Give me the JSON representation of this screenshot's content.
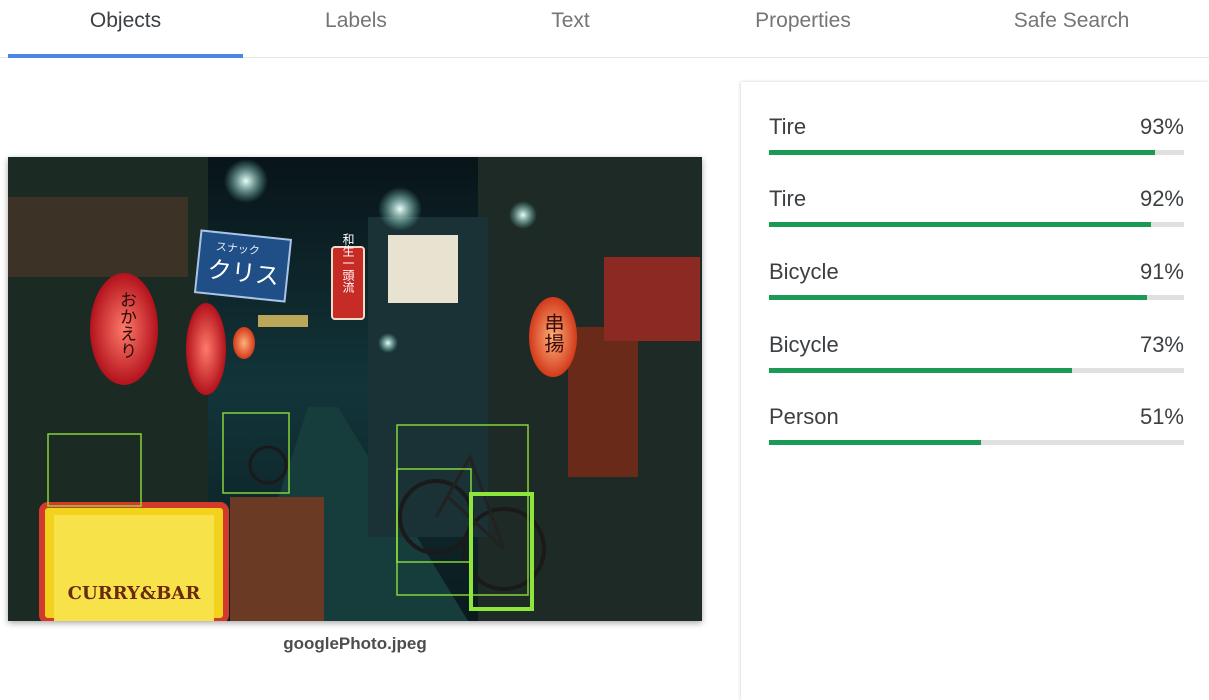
{
  "tabs": [
    {
      "label": "Objects",
      "active": true
    },
    {
      "label": "Labels",
      "active": false
    },
    {
      "label": "Text",
      "active": false
    },
    {
      "label": "Properties",
      "active": false
    },
    {
      "label": "Safe Search",
      "active": false
    }
  ],
  "image": {
    "caption": "googlePhoto.jpeg",
    "signs": {
      "snack_small": "スナック",
      "snack_name": "クリス",
      "vertical_red": "和生一頭流",
      "lantern_left": "おかえり",
      "lantern_right": "串揚",
      "curry_bar": "CURRY&BAR"
    }
  },
  "results": [
    {
      "name": "Tire",
      "percent": "93%",
      "score": 0.93
    },
    {
      "name": "Tire",
      "percent": "92%",
      "score": 0.92
    },
    {
      "name": "Bicycle",
      "percent": "91%",
      "score": 0.91
    },
    {
      "name": "Bicycle",
      "percent": "73%",
      "score": 0.73
    },
    {
      "name": "Person",
      "percent": "51%",
      "score": 0.51
    }
  ],
  "colors": {
    "accent": "#4a85e8",
    "bar_fill": "#1a9a54",
    "bar_track": "#e0e0e0",
    "box_outline": "#8fe63a"
  }
}
